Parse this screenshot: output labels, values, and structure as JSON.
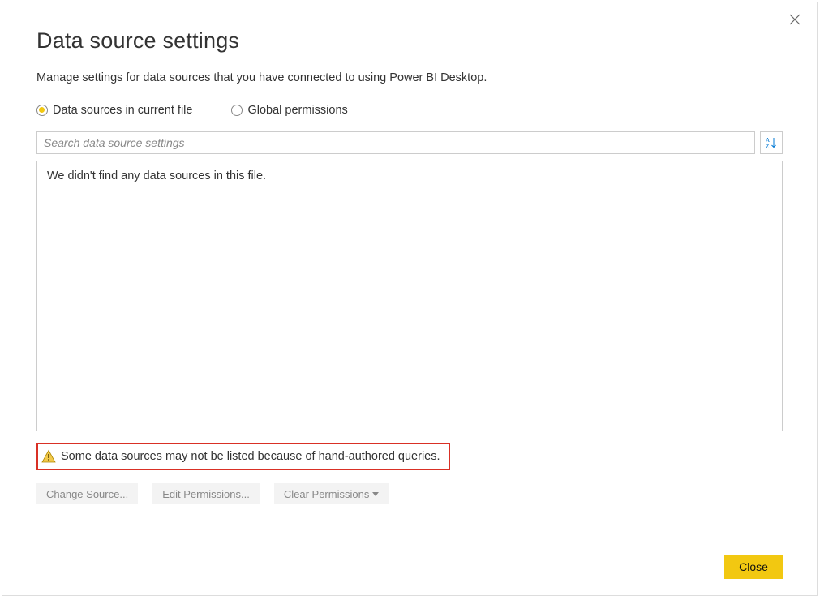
{
  "dialog": {
    "title": "Data source settings",
    "subtitle": "Manage settings for data sources that you have connected to using Power BI Desktop."
  },
  "radios": {
    "current_file": "Data sources in current file",
    "global": "Global permissions"
  },
  "search": {
    "placeholder": "Search data source settings"
  },
  "results": {
    "empty_message": "We didn't find any data sources in this file."
  },
  "warning": {
    "message": "Some data sources may not be listed because of hand-authored queries."
  },
  "actions": {
    "change_source": "Change Source...",
    "edit_permissions": "Edit Permissions...",
    "clear_permissions": "Clear Permissions"
  },
  "footer": {
    "close": "Close"
  }
}
